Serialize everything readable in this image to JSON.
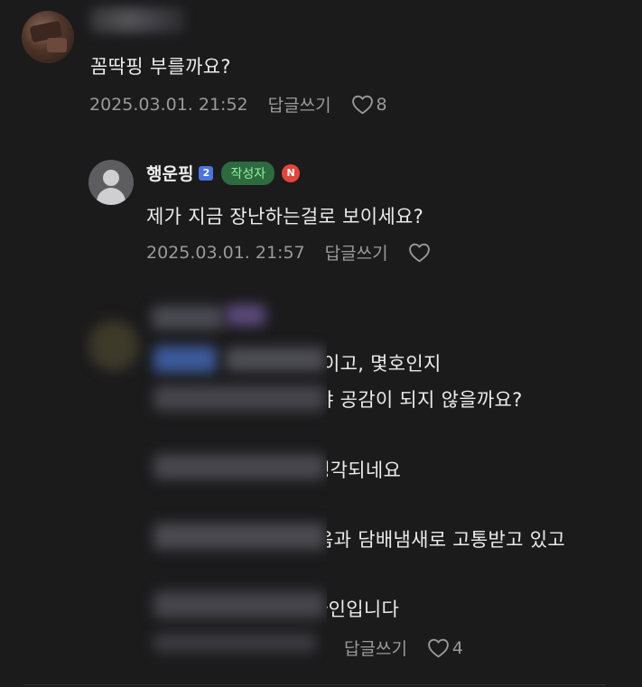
{
  "comments": [
    {
      "text": "꼼딱핑 부를까요?",
      "date": "2025.03.01. 21:52",
      "reply_label": "답글쓰기",
      "like_count": "8"
    },
    {
      "author": "행운핑",
      "level": "2",
      "writer_badge": "작성자",
      "new_badge": "N",
      "text": "제가 지금 장난하는걸로 보이세요?",
      "date": "2025.03.01. 21:57",
      "reply_label": "답글쓰기",
      "like_count": ""
    },
    {
      "lines": [
        ".이고, 몇호인지",
        "야 공감이 되지 않을까요?",
        "생각되네요",
        "음과 담배냄새로 고통받고 있고",
        "라인입니다"
      ],
      "reply_label": "답글쓰기",
      "like_count": "4"
    }
  ],
  "colors": {
    "background": "#1b1b1c",
    "text": "#ececec",
    "meta": "#9a9a9a",
    "writer_badge_bg": "#2d6a3e",
    "writer_badge_text": "#8ff0a8",
    "new_badge": "#e2463a",
    "level_badge": "#4c74e0"
  },
  "icons": {
    "like": "heart-outline-icon",
    "default_avatar": "person-silhouette-icon"
  }
}
